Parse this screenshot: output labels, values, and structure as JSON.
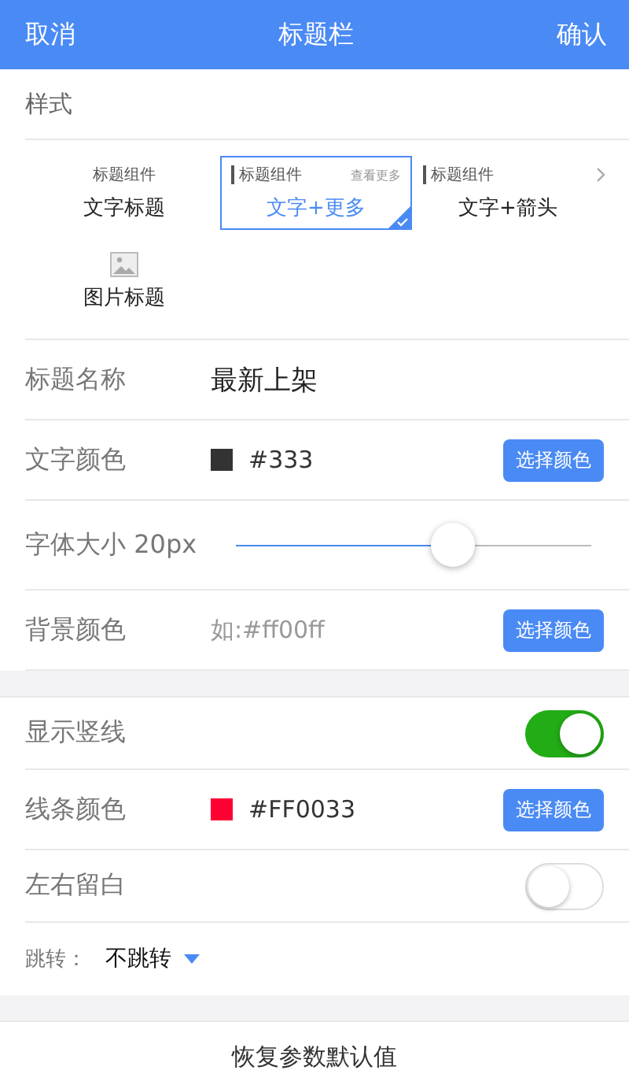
{
  "header": {
    "cancel": "取消",
    "title": "标题栏",
    "confirm": "确认"
  },
  "style_section": {
    "label": "样式",
    "options": [
      {
        "kind": "plain",
        "preview_title": "标题组件",
        "label": "文字标题",
        "selected": false
      },
      {
        "kind": "more",
        "preview_title": "标题组件",
        "preview_more": "查看更多",
        "label": "文字+更多",
        "selected": true
      },
      {
        "kind": "arrow",
        "preview_title": "标题组件",
        "label": "文字+箭头",
        "selected": false
      },
      {
        "kind": "image",
        "label": "图片标题",
        "selected": false
      }
    ]
  },
  "settings": [
    {
      "kind": "text",
      "label": "标题名称",
      "value": "最新上架"
    },
    {
      "kind": "color",
      "label": "文字颜色",
      "value": "#333",
      "color": "#333333",
      "button": "选择颜色"
    },
    {
      "kind": "slider",
      "label": "字体大小 20px",
      "level": 0.61
    },
    {
      "kind": "color",
      "label": "背景颜色",
      "placeholder": "如:#ff00ff",
      "button": "选择颜色"
    }
  ],
  "line_settings": [
    {
      "kind": "toggle",
      "label": "显示竖线",
      "on": true
    },
    {
      "kind": "color",
      "label": "线条颜色",
      "value": "#FF0033",
      "color": "#ff0033",
      "button": "选择颜色"
    },
    {
      "kind": "toggle",
      "label": "左右留白",
      "on": false
    },
    {
      "kind": "select",
      "label": "跳转：",
      "value": "不跳转"
    }
  ],
  "reset_button": "恢复参数默认值"
}
